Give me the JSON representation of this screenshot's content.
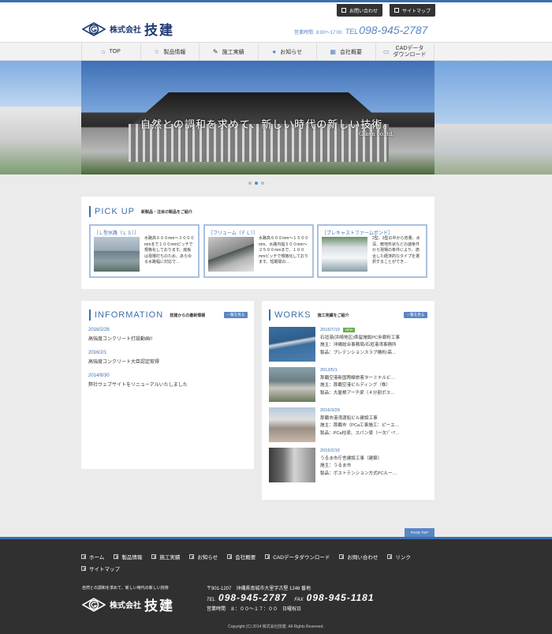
{
  "header": {
    "company_prefix": "株式会社",
    "company_name": "技建",
    "util_contact": "お問い合わせ",
    "util_sitemap": "サイトマップ",
    "hours_label": "営業時間",
    "hours": "8:00～17:00",
    "tel_prefix": "TEL",
    "tel": "098-945-2787"
  },
  "nav": {
    "items": [
      {
        "label": "TOP",
        "icon": "home-icon"
      },
      {
        "label": "製品情報",
        "icon": "star-icon"
      },
      {
        "label": "施工実績",
        "icon": "wrench-icon"
      },
      {
        "label": "お知らせ",
        "icon": "chat-icon"
      },
      {
        "label": "会社概要",
        "icon": "building-icon"
      },
      {
        "label": "CADデータ",
        "label2": "ダウンロード",
        "icon": "laptop-icon"
      }
    ]
  },
  "hero": {
    "copy": "自然との調和を求めて、新しい時代の新しい技術。",
    "sub": "Giken co.ltd."
  },
  "pickup": {
    "title": "PICK UP",
    "subtitle": "新製品・注目の製品をご紹介",
    "cards": [
      {
        "title": "［Ｌ型水路（ＬＳ）］",
        "text": "水路高６００mm～３０００mmまで１００mmピッチで規格化しております。底板は現場打ちのため、あらゆる水路幅に対応で…"
      },
      {
        "title": "［フリューム（ＦＬ）］",
        "text": "水路高６００mm～１５００mm、水路内幅５００mm～２５００mmまで、１００mmピッチで規格化しております。短期間の…"
      },
      {
        "title": "［プレキャストファームポンド］",
        "text": "2型、3型の中から容量、水深、敷地形状などの諸条件から現場の条件により、適合した経済的なタイプを選択することができ…"
      }
    ]
  },
  "information": {
    "title": "INFORMATION",
    "subtitle": "技建からの最新情報",
    "more": "一覧を見る",
    "items": [
      {
        "date": "2016/2/26",
        "text": "高強度コンクリート打設動画!!"
      },
      {
        "date": "2016/2/1",
        "text": "高強度コンクリート大臣認定取得"
      },
      {
        "date": "2014/9/30",
        "text": "弊社ウェブサイトをリニューアルいたしました"
      }
    ]
  },
  "works": {
    "title": "WORKS",
    "subtitle": "施工実績をご紹介",
    "more": "一覧を見る",
    "new_badge": "NEW",
    "items": [
      {
        "date": "2016/7/19",
        "is_new": true,
        "name": "石垣港(浜崎地区)係留施設PC歩廊桁工事",
        "client": "施主：沖縄総合事務局/石垣港湾事務所",
        "product": "製品：プレテンションスラブ橋桁/高…"
      },
      {
        "date": "2013/5/1",
        "is_new": false,
        "name": "那覇空港新国際線旅客ターミナルビ…",
        "client": "施主：那覇空港ビルディング（株）",
        "product": "製品：大屋根アーチ梁（４分割ポス…"
      },
      {
        "date": "2016/3/29",
        "is_new": false,
        "name": "那覇市港湾渡船ビル建設工事",
        "client": "施主：那覇市（PCa工事施工：ピーエ…",
        "product": "製品：PCa柱梁、スパン梁（一次ｿﾞｰｱ…"
      },
      {
        "date": "2016/2/16",
        "is_new": false,
        "name": "うるま市庁舎建設工事（建築）",
        "client": "施主：うるま市",
        "product": "製品：ポストテンション方式PCルー…"
      }
    ]
  },
  "page_top": "PAGE TOP",
  "footer": {
    "nav_row1": [
      "ホーム",
      "製品情報",
      "施工実績",
      "お知らせ",
      "会社概要",
      "CADデータダウンロード",
      "お問い合わせ",
      "リンク"
    ],
    "nav_row2": [
      "サイトマップ"
    ],
    "tagline": "自然との調和を求めて、新しい時代の新しい技術",
    "company_prefix": "株式会社",
    "company_name": "技建",
    "address": "〒901-1207　沖縄県南城市大里字古堅 1246 番地",
    "tel_label": "TEL",
    "tel": "098-945-2787",
    "fax_label": "FAX",
    "fax": "098-945-1181",
    "hours": "営業時間　８：００～１７：００　日曜祝日",
    "copyright": "Copyright (C) 2014 株式会社技建. All Rights Reserved."
  },
  "colors": {
    "accent": "#3a6fae",
    "button": "#5b86c4",
    "footer_bg": "#303030",
    "page_bg": "#ebebeb"
  }
}
